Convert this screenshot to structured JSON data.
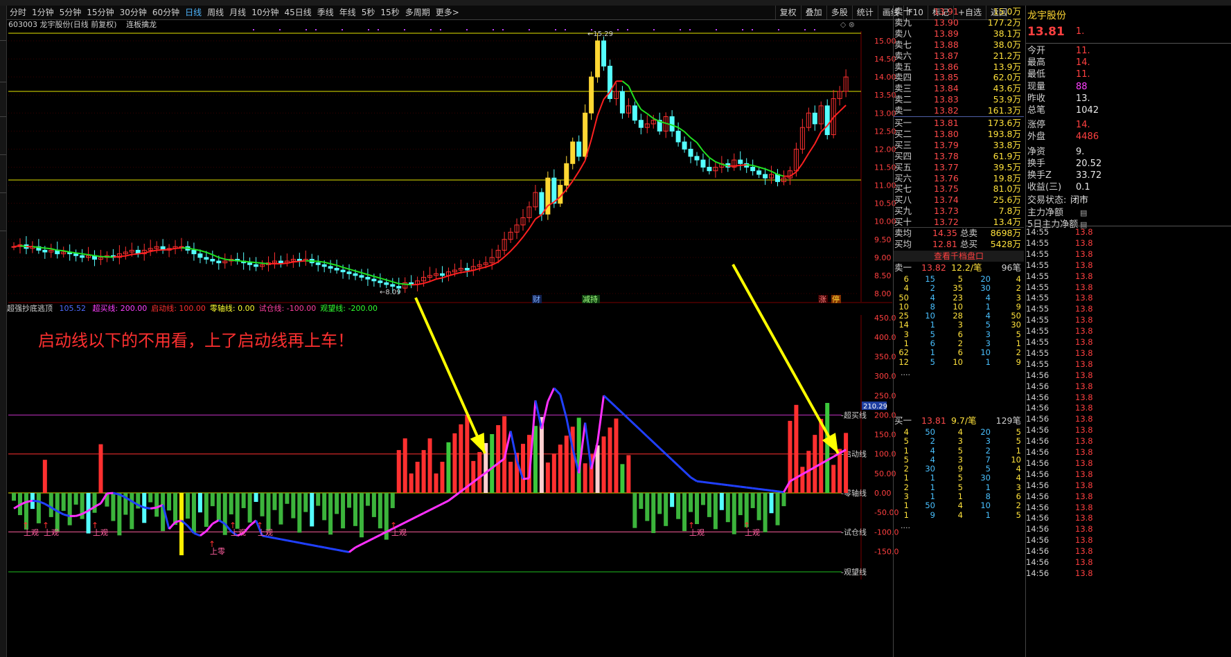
{
  "toolbar": {
    "periods": [
      "分时",
      "1分钟",
      "5分钟",
      "15分钟",
      "30分钟",
      "60分钟",
      "日线",
      "周线",
      "月线",
      "10分钟",
      "45日线",
      "季线",
      "年线",
      "5秒",
      "15秒",
      "多周期",
      "更多>"
    ],
    "active": "日线",
    "right_buttons": [
      "复权",
      "叠加",
      "多股",
      "统计",
      "画线",
      "F10",
      "标记",
      "+自选",
      "返回"
    ]
  },
  "header": {
    "stock_title": "603003 龙宇股份(日线 前复权)",
    "indicator_name": "连板擒龙"
  },
  "price_axis": [
    "15.00",
    "14.50",
    "14.00",
    "13.50",
    "13.00",
    "12.50",
    "12.00",
    "11.50",
    "11.00",
    "10.50",
    "10.00",
    "9.50",
    "9.00",
    "8.50",
    "8.00"
  ],
  "price_marks": {
    "high": "15.29",
    "low": "8.09"
  },
  "event_tags": {
    "cai": "财",
    "jianchi": "减持",
    "zhang": "涨",
    "ting": "停"
  },
  "lower_panel": {
    "name": "超强抄底逃顶",
    "current_value": "105.52",
    "legend": [
      {
        "text": "超买线: 200.00",
        "color": "#ff40ff"
      },
      {
        "text": "启动线: 100.00",
        "color": "#ff3030"
      },
      {
        "text": "零轴线: 0.00",
        "color": "#ffff30"
      },
      {
        "text": "试仓线: -100.00",
        "color": "#ff40a0"
      },
      {
        "text": "观望线: -200.00",
        "color": "#30ff30"
      }
    ],
    "annotation": "启动线以下的不用看，上了启动线再上车！",
    "axis": [
      "450.0",
      "400.0",
      "350.0",
      "300.0",
      "250.0",
      "200.0",
      "150.0",
      "100.0",
      "50.00",
      "0.00",
      "-50.00",
      "-100.0",
      "-150.0"
    ],
    "current_tag": "210.29",
    "line_labels": {
      "overbuy": "超买线",
      "start": "启动线",
      "zero": "零轴线",
      "trial": "试仓线",
      "watch": "观望线"
    },
    "signals": {
      "guan": "上观",
      "ling": "上零"
    }
  },
  "order_book": {
    "asks": [
      {
        "label": "卖十",
        "price": "13.91",
        "vol": "15.0万"
      },
      {
        "label": "卖九",
        "price": "13.90",
        "vol": "177.2万"
      },
      {
        "label": "卖八",
        "price": "13.89",
        "vol": "38.1万"
      },
      {
        "label": "卖七",
        "price": "13.88",
        "vol": "38.0万"
      },
      {
        "label": "卖六",
        "price": "13.87",
        "vol": "21.2万"
      },
      {
        "label": "卖五",
        "price": "13.86",
        "vol": "13.9万"
      },
      {
        "label": "卖四",
        "price": "13.85",
        "vol": "62.0万"
      },
      {
        "label": "卖三",
        "price": "13.84",
        "vol": "43.6万"
      },
      {
        "label": "卖二",
        "price": "13.83",
        "vol": "53.9万"
      },
      {
        "label": "卖一",
        "price": "13.82",
        "vol": "161.3万"
      }
    ],
    "bids": [
      {
        "label": "买一",
        "price": "13.81",
        "vol": "173.6万"
      },
      {
        "label": "买二",
        "price": "13.80",
        "vol": "193.8万"
      },
      {
        "label": "买三",
        "price": "13.79",
        "vol": "33.8万"
      },
      {
        "label": "买四",
        "price": "13.78",
        "vol": "61.9万"
      },
      {
        "label": "买五",
        "price": "13.77",
        "vol": "39.5万"
      },
      {
        "label": "买六",
        "price": "13.76",
        "vol": "19.8万"
      },
      {
        "label": "买七",
        "price": "13.75",
        "vol": "81.0万"
      },
      {
        "label": "买八",
        "price": "13.74",
        "vol": "25.6万"
      },
      {
        "label": "买九",
        "price": "13.73",
        "vol": "7.8万"
      },
      {
        "label": "买十",
        "price": "13.72",
        "vol": "13.4万"
      }
    ],
    "avg_sell": {
      "label": "卖均",
      "price": "14.35",
      "total_label": "总卖",
      "total": "8698万"
    },
    "avg_buy": {
      "label": "买均",
      "price": "12.81",
      "total_label": "总买",
      "total": "5428万"
    },
    "view_btn": "查看千档盘口",
    "sell1_queue": {
      "label": "卖一",
      "price": "13.82",
      "avg": "12.2/笔",
      "count": "96笔"
    },
    "sell1_rows": [
      [
        "6",
        "15",
        "5",
        "20",
        "4"
      ],
      [
        "4",
        "2",
        "35",
        "30",
        "2"
      ],
      [
        "50",
        "4",
        "23",
        "4",
        "3"
      ],
      [
        "10",
        "8",
        "10",
        "1",
        "9"
      ],
      [
        "25",
        "10",
        "28",
        "4",
        "50"
      ],
      [
        "14",
        "1",
        "3",
        "5",
        "30"
      ],
      [
        "3",
        "5",
        "6",
        "3",
        "5"
      ],
      [
        "1",
        "6",
        "2",
        "3",
        "1"
      ],
      [
        "62",
        "1",
        "6",
        "10",
        "2"
      ],
      [
        "12",
        "5",
        "10",
        "1",
        "9"
      ]
    ],
    "buy1_queue": {
      "label": "买一",
      "price": "13.81",
      "avg": "9.7/笔",
      "count": "129笔"
    },
    "buy1_rows": [
      [
        "4",
        "50",
        "4",
        "20",
        "5"
      ],
      [
        "5",
        "2",
        "3",
        "3",
        "5"
      ],
      [
        "1",
        "4",
        "5",
        "2",
        "1"
      ],
      [
        "5",
        "4",
        "3",
        "7",
        "10"
      ],
      [
        "2",
        "30",
        "9",
        "5",
        "4"
      ],
      [
        "1",
        "1",
        "5",
        "30",
        "4"
      ],
      [
        "2",
        "1",
        "5",
        "1",
        "3"
      ],
      [
        "3",
        "1",
        "1",
        "8",
        "6"
      ],
      [
        "1",
        "50",
        "4",
        "10",
        "2"
      ],
      [
        "1",
        "9",
        "4",
        "1",
        "5"
      ]
    ],
    "ellipsis": "...."
  },
  "quote": {
    "name": "龙宇股份",
    "price": "13.81",
    "change_fragment": "1.",
    "rows": [
      {
        "k": "今开",
        "v": "11."
      },
      {
        "k": "最高",
        "v": "14."
      },
      {
        "k": "最低",
        "v": "11."
      },
      {
        "k": "现量",
        "v": "88"
      },
      {
        "k": "昨收",
        "v": "13."
      },
      {
        "k": "总笔",
        "v": "1042"
      },
      {
        "k": "涨停",
        "v": "14."
      },
      {
        "k": "外盘",
        "v": "4486"
      },
      {
        "k": "净资",
        "v": "9."
      },
      {
        "k": "换手",
        "v": "20.52"
      },
      {
        "k": "换手Z",
        "v": "33.72"
      },
      {
        "k": "收益(三)",
        "v": "0.1"
      },
      {
        "k": "交易状态:",
        "v": "闭市"
      },
      {
        "k": "主力净额",
        "v": ""
      },
      {
        "k": "5日主力净额",
        "v": ""
      }
    ],
    "ticks": [
      "14:55",
      "14:55",
      "14:55",
      "14:55",
      "14:55",
      "14:55",
      "14:55",
      "14:55",
      "14:55",
      "14:55",
      "14:55",
      "14:55",
      "14:55",
      "14:56",
      "14:56",
      "14:56",
      "14:56",
      "14:56",
      "14:56",
      "14:56",
      "14:56",
      "14:56",
      "14:56",
      "14:56",
      "14:56",
      "14:56",
      "14:56",
      "14:56",
      "14:56",
      "14:56",
      "14:56",
      "14:56"
    ],
    "tick_price": "13.8"
  },
  "colors": {
    "up": "#ff3030",
    "down": "#54ffff",
    "ma_up": "#ff2020",
    "ma_down": "#20e020",
    "hline": "#e6e600",
    "text_price": "#ff4a4a",
    "vol": "#ffe23c"
  }
}
